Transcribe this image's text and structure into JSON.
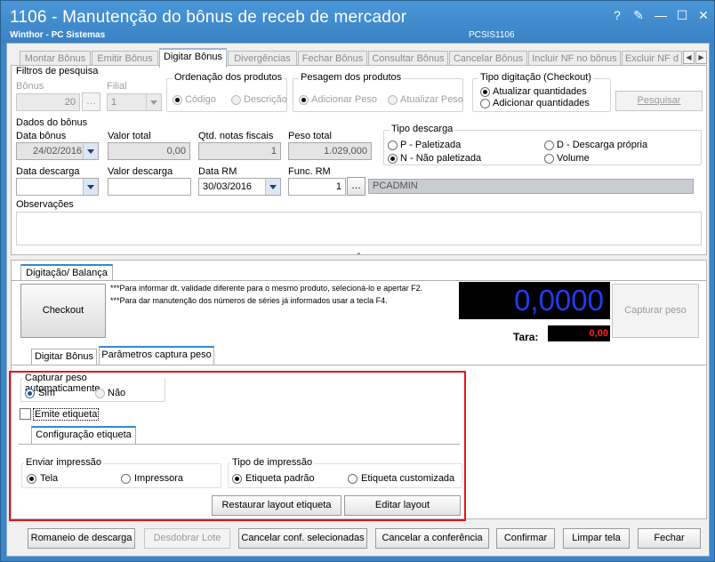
{
  "window": {
    "title": "1106 - Manutenção do bônus de receb de mercador",
    "subtitle": "Winthor - PC Sistemas",
    "code": "PCSIS1106",
    "controls": [
      "?",
      "✎",
      "—",
      "☐",
      "✕"
    ]
  },
  "tabs": [
    "Montar Bônus",
    "Emitir Bônus",
    "Digitar Bônus",
    "Divergências",
    "Fechar Bônus",
    "Consultar Bônus",
    "Cancelar Bônus",
    "Incluir NF no bônus",
    "Excluir NF d"
  ],
  "filtros": {
    "title": "Filtros de pesquisa",
    "bonus_label": "Bônus",
    "bonus_value": "20",
    "filial_label": "Filial",
    "filial_value": "1",
    "ordenacao": {
      "title": "Ordenação dos produtos",
      "opt1": "Código",
      "opt2": "Descrição"
    },
    "pesagem": {
      "title": "Pesagem dos produtos",
      "opt1": "Adicionar Peso",
      "opt2": "Atualizar Peso"
    },
    "tipo_digitacao": {
      "title": "Tipo digitação (Checkout)",
      "opt1": "Atualizar quantidades",
      "opt2": "Adicionar quantidades"
    },
    "pesquisar": "Pesquisar"
  },
  "dados": {
    "title": "Dados do bônus",
    "data_bonus_label": "Data bônus",
    "data_bonus_value": "24/02/2016",
    "valor_total_label": "Valor total",
    "valor_total_value": "0,00",
    "qtd_notas_label": "Qtd. notas fiscais",
    "qtd_notas_value": "1",
    "peso_total_label": "Peso total",
    "peso_total_value": "1.029,000",
    "tipo_descarga": {
      "title": "Tipo descarga",
      "p": "P - Paletizada",
      "n": "N - Não paletizada",
      "d": "D - Descarga própria",
      "v": "Volume"
    },
    "data_descarga_label": "Data descarga",
    "valor_descarga_label": "Valor descarga",
    "data_rm_label": "Data RM",
    "data_rm_value": "30/03/2016",
    "func_rm_label": "Func. RM",
    "func_rm_value": "1",
    "func_rm_name": "PCADMIN",
    "observacoes_label": "Observações"
  },
  "lower": {
    "tab": "Digitação/ Balança",
    "checkout": "Checkout",
    "note1": "***Para informar dt. validade diferente para o mesmo produto, selecioná-lo e apertar F2.",
    "note2": "***Para dar manutenção dos números de séries já informados  usar a tecla F4.",
    "weight": "0,0000",
    "tara_label": "Tara:",
    "tara_value": "0,00",
    "capturar_peso": "Capturar peso",
    "subtab1": "Digitar Bônus",
    "subtab2": "Parâmetros captura peso",
    "captura_auto": {
      "title": "Capturar peso automaticamente",
      "sim": "Sim",
      "nao": "Não"
    },
    "emite_etiqueta": "Emite etiqueta",
    "config_tab": "Configuração etiqueta",
    "enviar": {
      "title": "Enviar impressão",
      "tela": "Tela",
      "impressora": "Impressora"
    },
    "tipo_impressao": {
      "title": "Tipo de impressão",
      "padrao": "Etiqueta padrão",
      "custom": "Etiqueta customizada"
    },
    "restaurar": "Restaurar layout etiqueta",
    "editar": "Editar layout"
  },
  "footer": {
    "romaneio": "Romaneio de descarga",
    "desdobrar": "Desdobrar Lote",
    "cancelar_conf": "Cancelar conf. selecionadas",
    "cancelar_conferencia": "Cancelar a conferência",
    "confirmar": "Confirmar",
    "limpar": "Limpar tela",
    "fechar": "Fechar"
  },
  "colors": {
    "title_bar": "#3a86c9",
    "highlight": "#e3141e",
    "scale_bg": "#000000",
    "scale_digits": "#1f3cf0",
    "tara_digits": "#ff2020"
  }
}
